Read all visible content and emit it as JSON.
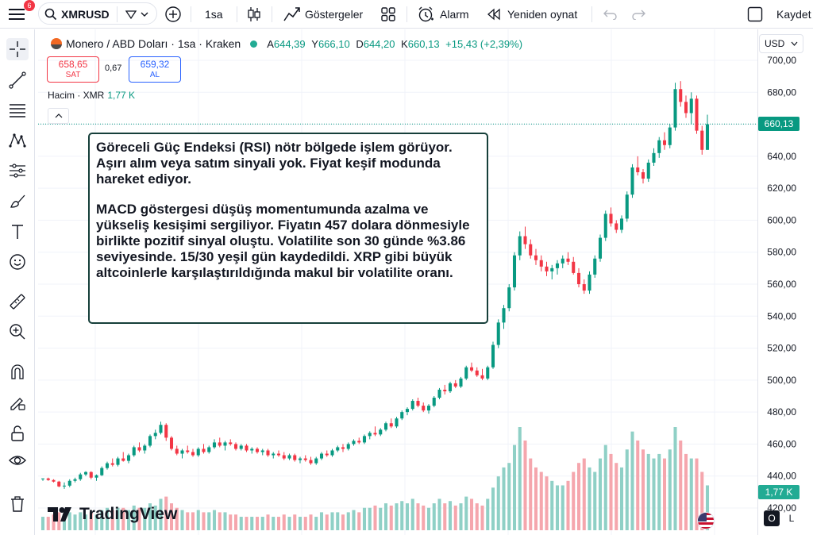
{
  "topbar": {
    "notifications": "6",
    "symbol": "XMRUSD",
    "interval": "1sa",
    "indicators_label": "Göstergeler",
    "alert_label": "Alarm",
    "replay_label": "Yeniden oynat",
    "save_label": "Kaydet"
  },
  "legend": {
    "title": "Monero / ABD Doları · 1sa · Kraken",
    "open_key": "A",
    "open": "644,39",
    "high_key": "Y",
    "high": "666,10",
    "low_key": "D",
    "low": "644,20",
    "close_key": "K",
    "close": "660,13",
    "change": "+15,43 (+2,39%)"
  },
  "trade": {
    "sell_price": "658,65",
    "sell_label": "SAT",
    "spread": "0,67",
    "buy_price": "659,32",
    "buy_label": "AL"
  },
  "volume_legend": {
    "label": "Hacim · XMR",
    "value": "1,77 K"
  },
  "annotation": {
    "paragraph1": "Göreceli Güç Endeksi (RSI) nötr bölgede işlem görüyor. Aşırı alım veya satım sinyali yok. Fiyat keşif modunda hareket ediyor.",
    "paragraph2": "MACD göstergesi düşüş momentumunda azalma ve yükseliş kesişimi sergiliyor. Fiyatın 457 dolara dönmesiyle birlikte pozitif sinyal oluştu. Volatilite son 30 günde %3.86 seviyesinde. 15/30 yeşil gün kaydedildi.  XRP gibi büyük altcoinlerle karşılaştırıldığında makul bir volatilite oranı."
  },
  "axis": {
    "currency": "USD",
    "last_price_label": "660,13",
    "volume_label": "1,77 K"
  },
  "branding": {
    "name": "TradingView"
  },
  "scale_mode": {
    "o": "O",
    "l": "L"
  },
  "colors": {
    "up": "#089981",
    "down": "#f23645",
    "up_volume": "#8fd0c6",
    "down_volume": "#f5a6ad",
    "annotation_border": "#163f3a"
  },
  "chart_data": {
    "type": "candlestick",
    "symbol": "XMRUSD",
    "interval": "1h",
    "ylim": [
      420,
      700
    ],
    "y_ticks": [
      "700,00",
      "680,00",
      "660,00",
      "640,00",
      "620,00",
      "600,00",
      "580,00",
      "560,00",
      "540,00",
      "520,00",
      "500,00",
      "480,00",
      "460,00",
      "440,00",
      "420,00"
    ],
    "y_tick_values": [
      700,
      680,
      660,
      640,
      620,
      600,
      580,
      560,
      540,
      520,
      500,
      480,
      460,
      440,
      420
    ],
    "last_price": 660.13,
    "candles": [
      [
        438,
        438.5,
        437,
        438.5,
        0.3
      ],
      [
        438.5,
        439,
        437,
        437.5,
        0.3
      ],
      [
        437.5,
        438,
        436,
        436.5,
        0.35
      ],
      [
        436.5,
        437,
        433,
        433.5,
        0.4
      ],
      [
        433.5,
        436,
        432,
        434,
        0.35
      ],
      [
        434,
        438,
        433,
        437,
        0.4
      ],
      [
        437,
        439,
        436,
        438,
        0.35
      ],
      [
        438,
        442,
        437,
        441,
        0.4
      ],
      [
        441,
        443,
        440,
        442.5,
        0.35
      ],
      [
        442.5,
        443,
        438,
        439,
        0.4
      ],
      [
        439,
        441,
        437,
        440.5,
        0.35
      ],
      [
        440.5,
        446,
        440,
        445,
        0.45
      ],
      [
        445,
        449,
        444,
        448,
        0.5
      ],
      [
        448,
        451,
        446,
        447,
        0.45
      ],
      [
        447,
        452,
        446,
        451,
        0.5
      ],
      [
        451,
        455,
        449,
        449.5,
        0.5
      ],
      [
        449.5,
        454,
        448,
        453,
        0.45
      ],
      [
        453,
        459,
        452,
        458,
        0.55
      ],
      [
        458,
        461,
        455,
        456,
        0.5
      ],
      [
        456,
        460,
        454,
        459,
        0.5
      ],
      [
        459,
        466,
        458,
        465,
        0.6
      ],
      [
        465,
        469,
        463,
        467,
        0.55
      ],
      [
        467,
        474,
        466,
        472,
        0.7
      ],
      [
        472,
        473,
        462,
        464,
        0.75
      ],
      [
        464,
        465,
        456,
        457,
        0.6
      ],
      [
        457,
        459,
        453,
        454,
        0.5
      ],
      [
        454,
        457,
        451,
        456,
        0.45
      ],
      [
        456,
        459,
        454,
        455,
        0.4
      ],
      [
        455,
        457,
        452,
        453,
        0.4
      ],
      [
        453,
        458,
        452,
        457,
        0.45
      ],
      [
        457,
        460,
        454,
        455,
        0.4
      ],
      [
        455,
        459,
        454,
        458,
        0.4
      ],
      [
        458,
        463,
        457,
        461,
        0.45
      ],
      [
        461,
        464,
        458,
        459,
        0.4
      ],
      [
        459,
        462,
        456,
        461,
        0.4
      ],
      [
        461,
        463,
        459,
        460,
        0.35
      ],
      [
        460,
        461,
        456,
        457,
        0.35
      ],
      [
        457,
        460,
        456,
        459,
        0.3
      ],
      [
        459,
        460,
        455,
        456,
        0.3
      ],
      [
        456,
        458,
        454,
        457,
        0.3
      ],
      [
        457,
        458,
        454,
        455,
        0.3
      ],
      [
        455,
        457,
        453,
        456,
        0.3
      ],
      [
        456,
        457,
        452,
        453,
        0.35
      ],
      [
        453,
        455,
        451,
        454,
        0.3
      ],
      [
        454,
        456,
        452,
        453,
        0.3
      ],
      [
        453,
        455,
        450,
        451,
        0.35
      ],
      [
        451,
        454,
        450,
        453,
        0.3
      ],
      [
        453,
        454,
        449,
        450,
        0.35
      ],
      [
        450,
        452,
        448,
        451,
        0.3
      ],
      [
        451,
        453,
        449,
        450,
        0.3
      ],
      [
        450,
        452,
        447,
        448,
        0.35
      ],
      [
        448,
        452,
        447,
        451,
        0.3
      ],
      [
        451,
        455,
        450,
        454,
        0.4
      ],
      [
        454,
        456,
        452,
        453,
        0.35
      ],
      [
        453,
        457,
        452,
        456,
        0.4
      ],
      [
        456,
        459,
        455,
        458,
        0.4
      ],
      [
        458,
        460,
        455,
        457,
        0.35
      ],
      [
        457,
        461,
        456,
        460,
        0.4
      ],
      [
        460,
        463,
        459,
        462,
        0.45
      ],
      [
        462,
        464,
        460,
        461,
        0.4
      ],
      [
        461,
        466,
        460,
        465,
        0.5
      ],
      [
        465,
        468,
        463,
        467,
        0.5
      ],
      [
        467,
        471,
        465,
        466,
        0.55
      ],
      [
        466,
        470,
        465,
        469,
        0.5
      ],
      [
        469,
        474,
        468,
        473,
        0.6
      ],
      [
        473,
        476,
        470,
        471,
        0.55
      ],
      [
        471,
        477,
        470,
        476,
        0.6
      ],
      [
        476,
        481,
        475,
        480,
        0.65
      ],
      [
        480,
        483,
        478,
        482,
        0.6
      ],
      [
        482,
        488,
        481,
        487,
        0.7
      ],
      [
        487,
        489,
        483,
        484,
        0.6
      ],
      [
        484,
        486,
        480,
        481,
        0.55
      ],
      [
        481,
        485,
        479,
        484,
        0.5
      ],
      [
        484,
        490,
        483,
        489,
        0.6
      ],
      [
        489,
        495,
        488,
        494,
        0.7
      ],
      [
        494,
        497,
        491,
        493,
        0.6
      ],
      [
        493,
        499,
        492,
        498,
        0.65
      ],
      [
        498,
        500,
        495,
        496,
        0.55
      ],
      [
        496,
        502,
        495,
        501,
        0.6
      ],
      [
        501,
        509,
        500,
        508,
        0.75
      ],
      [
        508,
        511,
        505,
        506,
        0.7
      ],
      [
        506,
        508,
        502,
        503,
        0.6
      ],
      [
        503,
        507,
        500,
        501,
        0.55
      ],
      [
        501,
        509,
        500,
        508,
        0.7
      ],
      [
        508,
        524,
        507,
        522,
        0.95
      ],
      [
        522,
        538,
        520,
        536,
        1.2
      ],
      [
        536,
        547,
        532,
        545,
        1.4
      ],
      [
        545,
        560,
        543,
        558,
        1.5
      ],
      [
        558,
        580,
        556,
        578,
        1.9
      ],
      [
        578,
        593,
        575,
        590,
        2.3
      ],
      [
        590,
        596,
        582,
        585,
        2.0
      ],
      [
        585,
        588,
        576,
        578,
        1.6
      ],
      [
        578,
        582,
        572,
        575,
        1.4
      ],
      [
        575,
        578,
        568,
        571,
        1.3
      ],
      [
        571,
        574,
        565,
        568,
        1.2
      ],
      [
        568,
        572,
        563,
        570,
        1.1
      ],
      [
        570,
        575,
        566,
        573,
        1.0
      ],
      [
        573,
        578,
        570,
        576,
        1.0
      ],
      [
        576,
        580,
        572,
        574,
        1.1
      ],
      [
        574,
        577,
        566,
        567,
        1.3
      ],
      [
        567,
        570,
        558,
        560,
        1.5
      ],
      [
        560,
        563,
        554,
        556,
        1.6
      ],
      [
        556,
        568,
        554,
        566,
        1.4
      ],
      [
        566,
        578,
        564,
        576,
        1.3
      ],
      [
        576,
        591,
        574,
        589,
        1.6
      ],
      [
        589,
        606,
        587,
        604,
        1.9
      ],
      [
        604,
        608,
        596,
        598,
        1.7
      ],
      [
        598,
        600,
        592,
        594,
        1.5
      ],
      [
        594,
        603,
        592,
        601,
        1.4
      ],
      [
        601,
        618,
        599,
        616,
        1.8
      ],
      [
        616,
        635,
        614,
        633,
        2.2
      ],
      [
        633,
        640,
        628,
        630,
        2.0
      ],
      [
        630,
        632,
        623,
        626,
        1.8
      ],
      [
        626,
        638,
        624,
        636,
        1.7
      ],
      [
        636,
        645,
        634,
        642,
        1.6
      ],
      [
        642,
        652,
        639,
        650,
        1.7
      ],
      [
        650,
        655,
        644,
        647,
        1.6
      ],
      [
        647,
        660,
        645,
        658,
        1.8
      ],
      [
        658,
        686,
        656,
        682,
        2.3
      ],
      [
        682,
        687,
        671,
        674,
        2.0
      ],
      [
        674,
        678,
        664,
        667,
        1.7
      ],
      [
        667,
        680,
        660,
        676,
        1.6
      ],
      [
        676,
        678,
        654,
        656,
        1.6
      ],
      [
        656,
        659,
        641,
        644,
        1.3
      ],
      [
        644,
        666,
        644,
        660,
        1.0
      ]
    ]
  }
}
